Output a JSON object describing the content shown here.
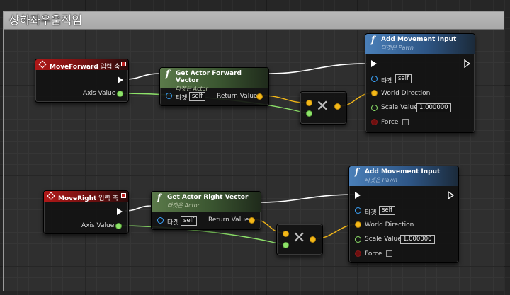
{
  "comment": {
    "title": "상하좌우움직임"
  },
  "groups": [
    {
      "event": {
        "name": "MoveForward",
        "suffix": " 입력 축",
        "output_label": "Axis Value"
      },
      "getter": {
        "title": "Get Actor Forward Vector",
        "subtitle": "타겟은 Actor",
        "target_label": "타겟",
        "target_value": "self",
        "return_label": "Return Value"
      },
      "multiply": {
        "symbol": "✕"
      },
      "move": {
        "title": "Add Movement Input",
        "subtitle": "타겟은 Pawn",
        "target_label": "타겟",
        "target_value": "self",
        "direction_label": "World Direction",
        "scale_label": "Scale Value",
        "scale_value": "1.000000",
        "force_label": "Force"
      }
    },
    {
      "event": {
        "name": "MoveRight",
        "suffix": " 입력 축",
        "output_label": "Axis Value"
      },
      "getter": {
        "title": "Get Actor Right Vector",
        "subtitle": "타겟은 Actor",
        "target_label": "타겟",
        "target_value": "self",
        "return_label": "Return Value"
      },
      "multiply": {
        "symbol": "✕"
      },
      "move": {
        "title": "Add Movement Input",
        "subtitle": "타겟은 Pawn",
        "target_label": "타겟",
        "target_value": "self",
        "direction_label": "World Direction",
        "scale_label": "Scale Value",
        "scale_value": "1.000000",
        "force_label": "Force"
      }
    }
  ],
  "colors": {
    "exec_wire": "#ffffff",
    "float_wire": "#8ee36a",
    "vector_wire": "#f4b818",
    "event_header": "#b01818",
    "pure_header": "#5b7a4a",
    "function_header": "#4a7fb8"
  },
  "icons": [
    "event-diamond-icon",
    "function-f-icon",
    "multiply-icon",
    "exec-pin-icon",
    "checkbox-icon"
  ]
}
